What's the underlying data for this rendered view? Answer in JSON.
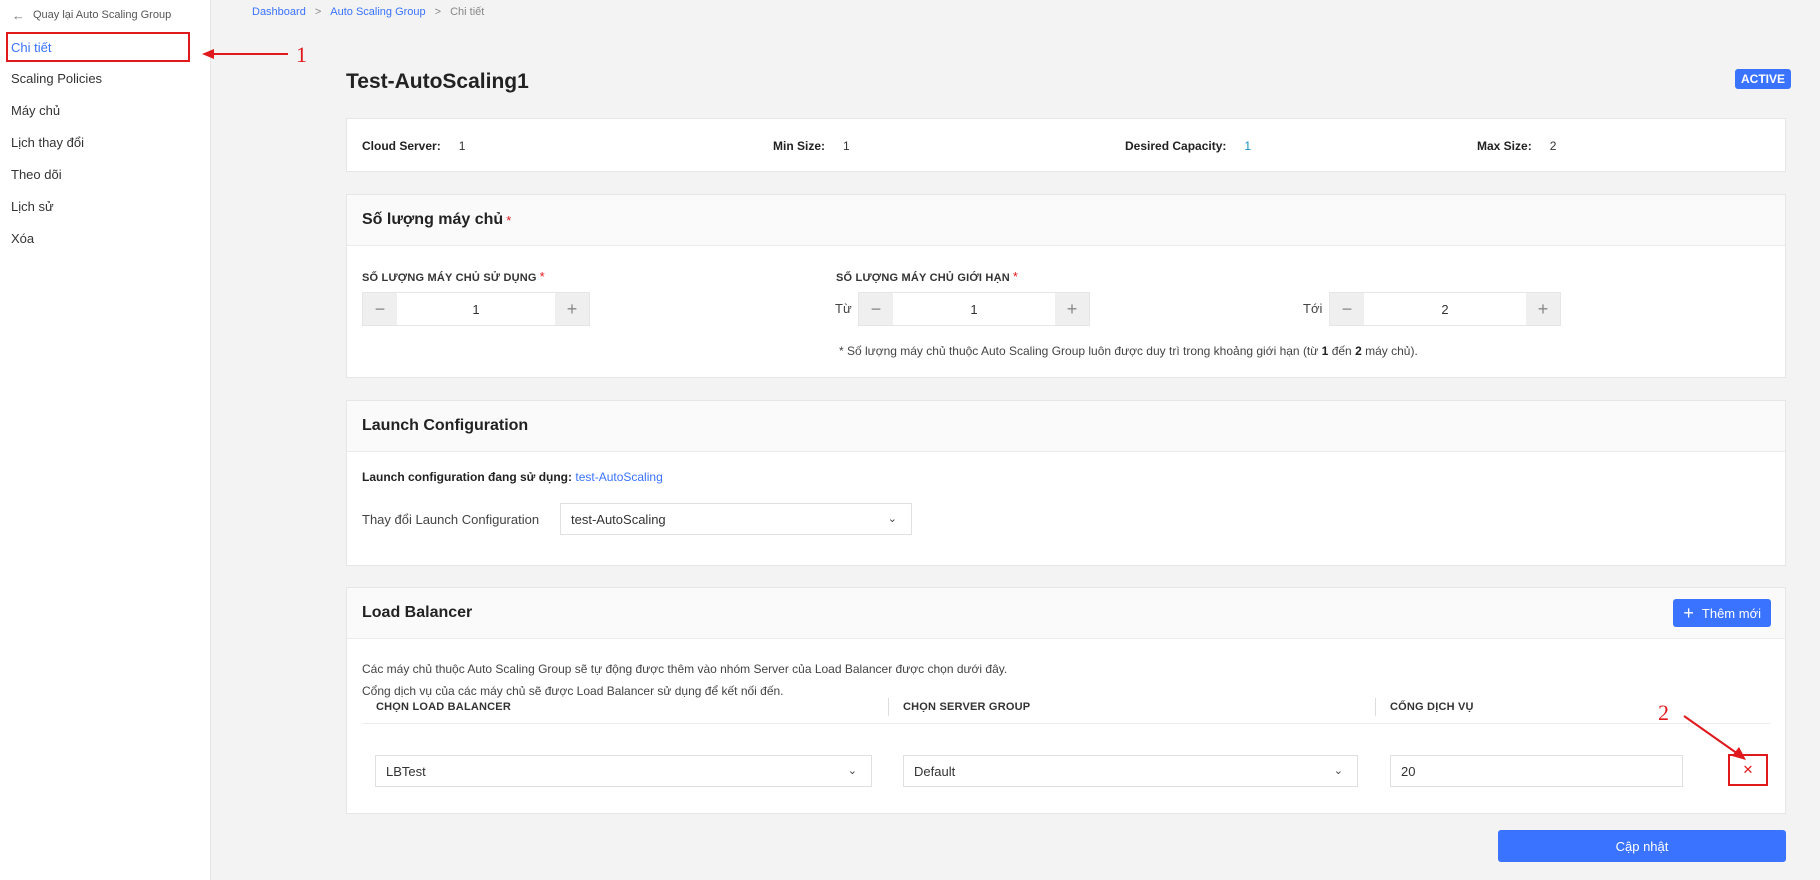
{
  "sidebar": {
    "back_label": "Quay lại Auto Scaling Group",
    "items": [
      {
        "label": "Chi tiết"
      },
      {
        "label": "Scaling Policies"
      },
      {
        "label": "Máy chủ"
      },
      {
        "label": "Lịch thay đổi"
      },
      {
        "label": "Theo dõi"
      },
      {
        "label": "Lịch sử"
      },
      {
        "label": "Xóa"
      }
    ]
  },
  "breadcrumb": {
    "items": [
      "Dashboard",
      "Auto Scaling Group",
      "Chi tiết"
    ],
    "separator": ">"
  },
  "page": {
    "title": "Test-AutoScaling1",
    "status": "ACTIVE"
  },
  "summary": {
    "cloud_server": {
      "label": "Cloud Server:",
      "value": "1"
    },
    "min_size": {
      "label": "Min Size:",
      "value": "1"
    },
    "desired": {
      "label": "Desired Capacity:",
      "value": "1"
    },
    "max_size": {
      "label": "Max Size:",
      "value": "2"
    }
  },
  "server_count": {
    "title": "Số lượng máy chủ",
    "required_mark": "*",
    "in_use_label": "SỐ LƯỢNG MÁY CHỦ SỬ DỤNG",
    "in_use_value": "1",
    "limit_label": "SỐ LƯỢNG MÁY CHỦ GIỚI HẠN",
    "from_label": "Từ",
    "from_value": "1",
    "to_label": "Tới",
    "to_value": "2",
    "note_prefix": "* Số lượng máy chủ thuộc Auto Scaling Group luôn được duy trì trong khoảng giới hạn (từ",
    "note_from": "1",
    "note_mid": "đến",
    "note_to": "2",
    "note_suffix": "máy chủ)."
  },
  "launch_config": {
    "title": "Launch Configuration",
    "current_label": "Launch configuration đang sử dụng:",
    "current_value": "test-AutoScaling",
    "change_label": "Thay đổi Launch Configuration",
    "selected": "test-AutoScaling"
  },
  "load_balancer": {
    "title": "Load Balancer",
    "add_label": "Thêm mới",
    "desc_line1": "Các máy chủ thuộc Auto Scaling Group sẽ tự động được thêm vào nhóm Server của Load Balancer được chọn dưới đây.",
    "desc_line2": "Cổng dịch vụ của các máy chủ sẽ được Load Balancer sử dụng để kết nối đến.",
    "columns": [
      "CHỌN LOAD BALANCER",
      "CHỌN SERVER GROUP",
      "CỔNG DỊCH VỤ"
    ],
    "row": {
      "lb": "LBTest",
      "server_group": "Default",
      "port": "20"
    }
  },
  "actions": {
    "update_label": "Cập nhật"
  },
  "annotations": {
    "one": "1",
    "two": "2",
    "color": "#e0191c"
  },
  "colors": {
    "accent": "#3a73ff",
    "annotation_red": "#e0191c"
  }
}
